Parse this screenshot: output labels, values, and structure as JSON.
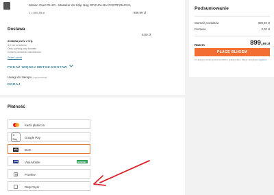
{
  "product": {
    "name": "Motion Over Dr.HO - Masażer do Stóp Nóg OFICJALNA DYSTRYBUCJA",
    "qty": "1 × 899,99 zł",
    "price": "899,99 zł"
  },
  "delivery": {
    "title": "Dostawa",
    "price": "0,00 zł",
    "method_name": "dostawa przez 2 vrp.",
    "info_lines": [
      "3,2 km od adresu",
      "Opis: parking przy kominie",
      "Godziny otwarcia: całodobowo"
    ],
    "change_link": "Zmień punkt",
    "more_methods": "POKAŻ WIĘCEJ METOD DOSTAW",
    "notes_label": "Uwagi do zakupu",
    "notes_optional": "(opcjonalnie)",
    "add_button": "DODAJ"
  },
  "payment": {
    "title": "Płatność",
    "options": [
      {
        "label": "Karta płatnicza",
        "icon": "mastercard-icon",
        "selected": false
      },
      {
        "label": "Google Pay",
        "icon": "google-pay-icon",
        "logo_text": "G Pay",
        "selected": false
      },
      {
        "label": "BLIK",
        "icon": "blik-icon",
        "logo_text": "blik",
        "selected": true
      },
      {
        "label": "Visa Mobile",
        "icon": "visa-mobile-icon",
        "logo_text": "VISA",
        "badge": "NOWOŚĆ",
        "selected": false
      },
      {
        "label": "Przelew",
        "icon": "bank-transfer-icon",
        "selected": false
      },
      {
        "label": "Raty PayU",
        "icon": "payu-installments-icon",
        "selected": false
      }
    ]
  },
  "summary": {
    "title": "Podsumowanie",
    "products_label": "Wartość produktów",
    "products_value": "899,99 zł",
    "delivery_label": "Dostawa",
    "delivery_value": "0,00 zł",
    "total_label": "Razem",
    "total_main": "899,",
    "total_cents": "99 zł",
    "pay_button": "PŁACĘ BLIKIEM",
    "legal_text": "W następnym kroku wpiszesz kod BLIK z aplikacji banku. Płacąc, akceptujesz",
    "legal_link": "regulamin"
  },
  "colors": {
    "accent_orange": "#f26e32",
    "link_teal": "#2f7f98",
    "annotation_red": "#d9242c",
    "badge_green": "#2e9b57"
  }
}
